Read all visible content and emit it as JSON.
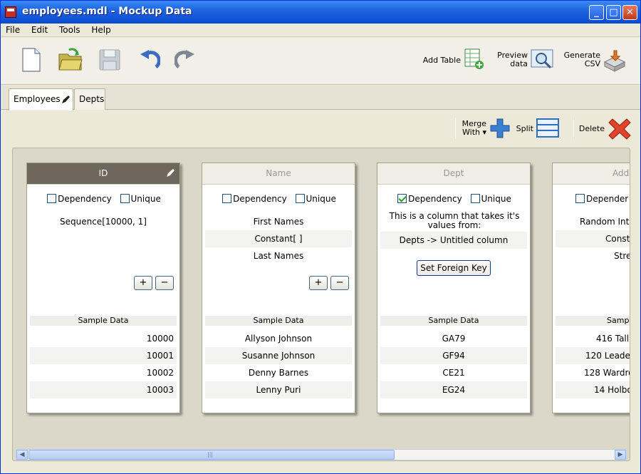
{
  "window": {
    "title": "employees.mdl - Mockup Data",
    "minimize": "_",
    "maximize": "□",
    "close": "✕"
  },
  "menu": [
    "File",
    "Edit",
    "Tools",
    "Help"
  ],
  "toolbar": {
    "add_table": "Add Table",
    "preview_line1": "Preview",
    "preview_line2": "data",
    "generate_line1": "Generate",
    "generate_line2": "CSV"
  },
  "tabs": [
    {
      "label": "Employees",
      "active": true
    },
    {
      "label": "Depts",
      "active": false
    }
  ],
  "actions": {
    "merge_line1": "Merge",
    "merge_line2": "With ▾",
    "split": "Split",
    "delete": "Delete"
  },
  "columns": [
    {
      "name": "ID",
      "selected": true,
      "dependency": false,
      "unique": false,
      "dependency_label": "Dependency",
      "unique_label": "Unique",
      "generators": [
        "Sequence[10000, 1]"
      ],
      "sample_header": "Sample Data",
      "samples": [
        "10000",
        "10001",
        "10002",
        "10003"
      ]
    },
    {
      "name": "Name",
      "selected": false,
      "dependency": false,
      "unique": false,
      "dependency_label": "Dependency",
      "unique_label": "Unique",
      "generators": [
        "First Names",
        "Constant[ ]",
        "Last Names"
      ],
      "sample_header": "Sample Data",
      "samples": [
        "Allyson Johnson",
        "Susanne Johnson",
        "Denny Barnes",
        "Lenny Puri"
      ]
    },
    {
      "name": "Dept",
      "selected": false,
      "dependency": true,
      "unique": false,
      "dependency_label": "Dependency",
      "unique_label": "Unique",
      "info_line1": "This is a column that takes it's",
      "info_line2": "values from:",
      "source": "Depts -> Untitled column",
      "fk_button": "Set Foreign Key",
      "sample_header": "Sample Data",
      "samples": [
        "GA79",
        "GF94",
        "CE21",
        "EG24"
      ]
    },
    {
      "name": "Add",
      "selected": false,
      "dependency": false,
      "unique": false,
      "dependency_label": "Depender",
      "generators": [
        "Random Inte",
        "Const",
        "Stre"
      ],
      "sample_header": "Sampl",
      "samples": [
        "416 Talli",
        "120 Leader",
        "128 Wardro",
        "14 Holbo"
      ]
    }
  ],
  "buttons": {
    "plus": "+",
    "minus": "−"
  },
  "scroll": {
    "left": "◀",
    "right": "▶",
    "grip": "|||"
  }
}
